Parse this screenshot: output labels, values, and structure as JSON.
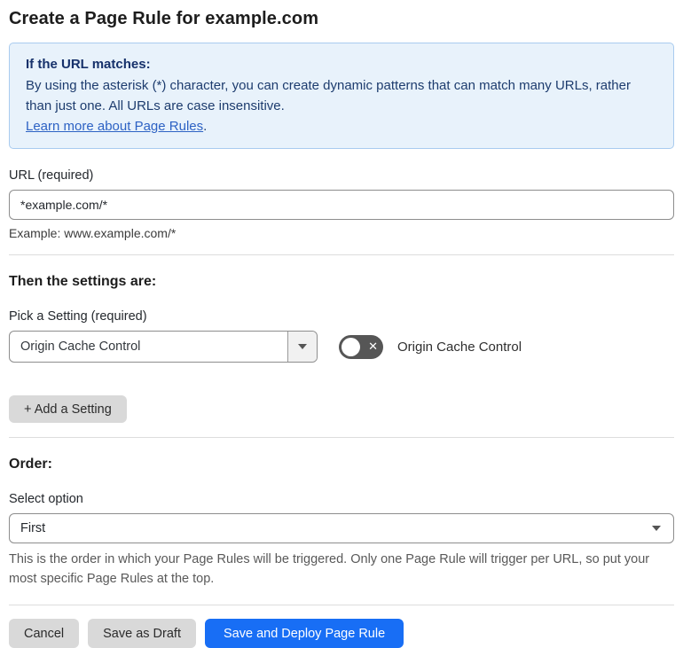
{
  "page": {
    "title": "Create a Page Rule for example.com"
  },
  "info_box": {
    "heading": "If the URL matches:",
    "body": "By using the asterisk (*) character, you can create dynamic patterns that can match many URLs, rather than just one. All URLs are case insensitive.",
    "link": "Learn more about Page Rules",
    "link_suffix": "."
  },
  "url_section": {
    "label": "URL (required)",
    "value": "*example.com/*",
    "example": "Example: www.example.com/*"
  },
  "settings_section": {
    "heading": "Then the settings are:",
    "pick_label": "Pick a Setting (required)",
    "selected_setting": "Origin Cache Control",
    "toggle_label": "Origin Cache Control",
    "toggle_state": "off",
    "add_button": "+ Add a Setting"
  },
  "order_section": {
    "heading": "Order:",
    "select_label": "Select option",
    "selected_option": "First",
    "help_text": "This is the order in which your Page Rules will be triggered. Only one Page Rule will trigger per URL, so put your most specific Page Rules at the top."
  },
  "footer": {
    "cancel": "Cancel",
    "save_draft": "Save as Draft",
    "save_deploy": "Save and Deploy Page Rule"
  },
  "icons": {
    "toggle_x": "✕"
  },
  "colors": {
    "accent_blue": "#186ef5",
    "info_bg": "#e8f2fb",
    "info_border": "#a9cbef",
    "info_text": "#1d3c6e",
    "link_blue": "#2d62c4",
    "toggle_off_bg": "#565656",
    "button_gray": "#d9d9d9"
  }
}
